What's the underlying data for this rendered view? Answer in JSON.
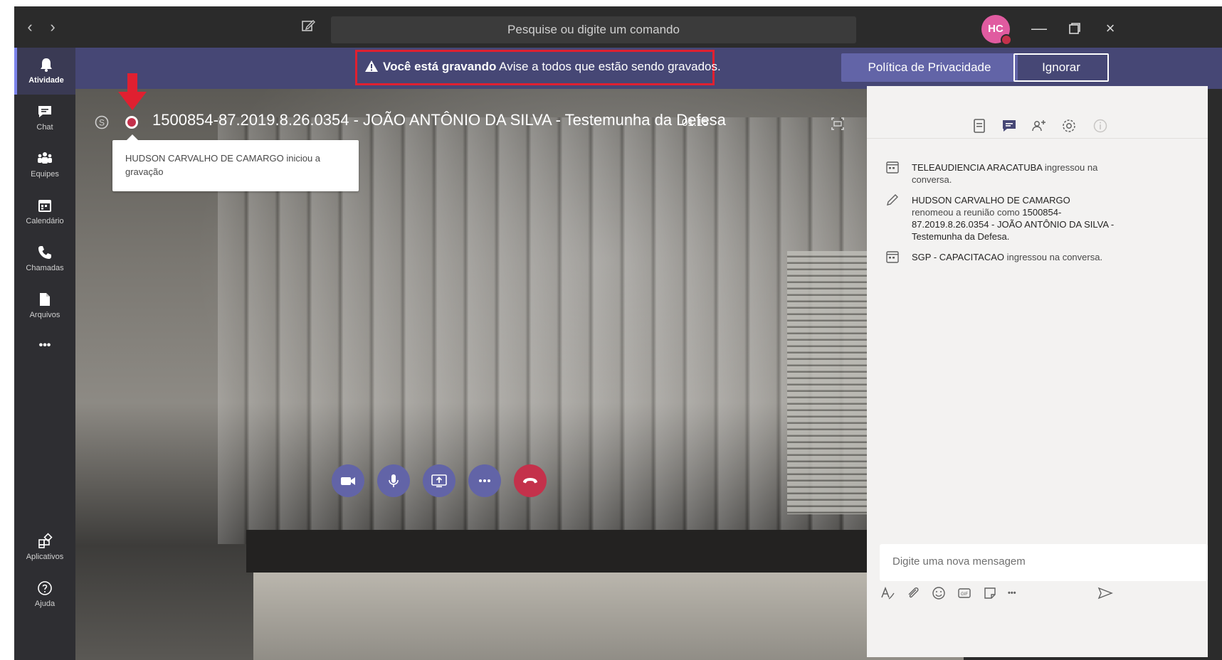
{
  "titlebar": {
    "back_glyph": "‹",
    "forward_glyph": "›",
    "search_placeholder": "Pesquise ou digite um comando",
    "avatar_initials": "HC",
    "minimize_glyph": "—",
    "close_glyph": "×"
  },
  "rail": {
    "items": [
      {
        "label": "Atividade",
        "icon": "bell-icon"
      },
      {
        "label": "Chat",
        "icon": "chat-icon"
      },
      {
        "label": "Equipes",
        "icon": "teams-icon"
      },
      {
        "label": "Calendário",
        "icon": "calendar-icon"
      },
      {
        "label": "Chamadas",
        "icon": "phone-icon"
      },
      {
        "label": "Arquivos",
        "icon": "file-icon"
      }
    ],
    "more_label": "•••",
    "bottom_items": [
      {
        "label": "Aplicativos",
        "icon": "apps-icon"
      },
      {
        "label": "Ajuda",
        "icon": "help-icon"
      }
    ]
  },
  "banner": {
    "bold_text": "Você está gravando",
    "text": "Avise a todos que estão sendo gravados.",
    "privacy_button": "Política de Privacidade",
    "ignore_button": "Ignorar"
  },
  "meeting": {
    "title": "1500854-87.2019.8.26.0354 - JOÃO ANTÔNIO DA SILVA - Testemunha da Defesa",
    "timer": "01:15",
    "tooltip": "HUDSON CARVALHO DE CAMARGO iniciou a gravação"
  },
  "controls": {
    "camera": "camera-icon",
    "mic": "microphone-icon",
    "share": "share-screen-icon",
    "more": "more-icon",
    "hangup": "hang-up-icon"
  },
  "chat": {
    "messages": [
      {
        "who": "TELEAUDIENCIA ARACATUBA",
        "text": " ingressou na conversa.",
        "icon": "join-icon"
      },
      {
        "who": "HUDSON CARVALHO DE CAMARGO",
        "text": "renomeou a reunião como ",
        "extra": "1500854-87.2019.8.26.0354 - JOÃO ANTÔNIO DA SILVA - Testemunha da Defesa.",
        "icon": "pencil-icon"
      },
      {
        "who": "SGP - CAPACITACAO",
        "text": " ingressou na conversa.",
        "icon": "join-icon"
      }
    ],
    "compose_placeholder": "Digite uma nova mensagem",
    "more_glyph": "•••"
  },
  "colors": {
    "banner_bg": "#464775",
    "accent": "#6264a7",
    "highlight_box": "#e02030",
    "hangup": "#c4314b"
  }
}
